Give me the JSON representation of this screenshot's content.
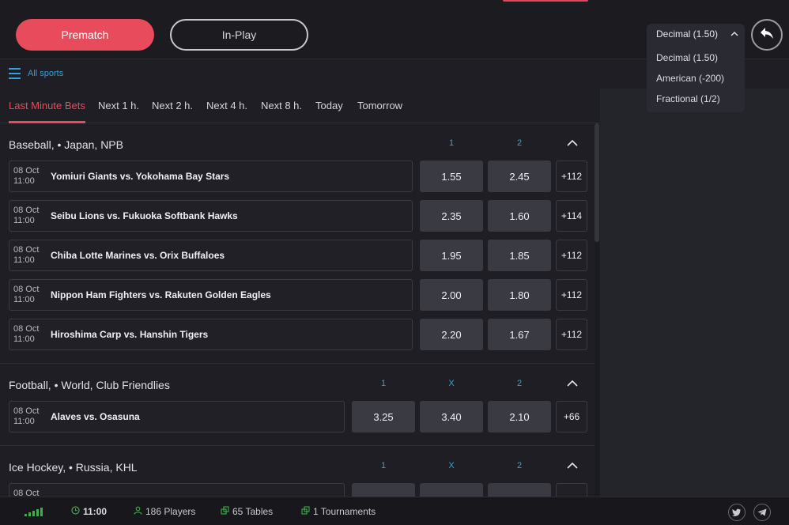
{
  "header": {
    "mode_tabs": [
      "Prematch",
      "In-Play"
    ],
    "odds_format": {
      "current": "Decimal (1.50)",
      "options": [
        "Decimal (1.50)",
        "American (-200)",
        "Fractional (1/2)"
      ]
    }
  },
  "sports_bar": {
    "label": "All sports"
  },
  "time_tabs": [
    "Last Minute Bets",
    "Next 1 h.",
    "Next 2 h.",
    "Next 4 h.",
    "Next 8 h.",
    "Today",
    "Tomorrow"
  ],
  "sections": [
    {
      "title": "Baseball, • Japan, NPB",
      "columns": [
        "1",
        "2"
      ],
      "events": [
        {
          "date": "08 Oct",
          "time": "11:00",
          "name": "Yomiuri Giants vs. Yokohama Bay Stars",
          "odds": [
            "1.55",
            "2.45"
          ],
          "more": "+112"
        },
        {
          "date": "08 Oct",
          "time": "11:00",
          "name": "Seibu Lions vs. Fukuoka Softbank Hawks",
          "odds": [
            "2.35",
            "1.60"
          ],
          "more": "+114"
        },
        {
          "date": "08 Oct",
          "time": "11:00",
          "name": "Chiba Lotte Marines vs. Orix Buffaloes",
          "odds": [
            "1.95",
            "1.85"
          ],
          "more": "+112"
        },
        {
          "date": "08 Oct",
          "time": "11:00",
          "name": "Nippon Ham Fighters vs. Rakuten Golden Eagles",
          "odds": [
            "2.00",
            "1.80"
          ],
          "more": "+112"
        },
        {
          "date": "08 Oct",
          "time": "11:00",
          "name": "Hiroshima Carp vs. Hanshin Tigers",
          "odds": [
            "2.20",
            "1.67"
          ],
          "more": "+112"
        }
      ]
    },
    {
      "title": "Football, • World, Club Friendlies",
      "columns": [
        "1",
        "X",
        "2"
      ],
      "events": [
        {
          "date": "08 Oct",
          "time": "11:00",
          "name": "Alaves vs. Osasuna",
          "odds": [
            "3.25",
            "3.40",
            "2.10"
          ],
          "more": "+66"
        }
      ]
    },
    {
      "title": "Ice Hockey, • Russia, KHL",
      "columns": [
        "1",
        "X",
        "2"
      ],
      "events": [
        {
          "date": "08 Oct",
          "time": "",
          "name": "",
          "odds": [
            "",
            "",
            ""
          ],
          "more": ""
        }
      ]
    }
  ],
  "footer": {
    "time": "11:00",
    "players": "186 Players",
    "tables": "65 Tables",
    "tournaments": "1 Tournaments"
  },
  "colors": {
    "accent": "#e84c5c",
    "link": "#2fa4d8",
    "online": "#3bb04a"
  }
}
